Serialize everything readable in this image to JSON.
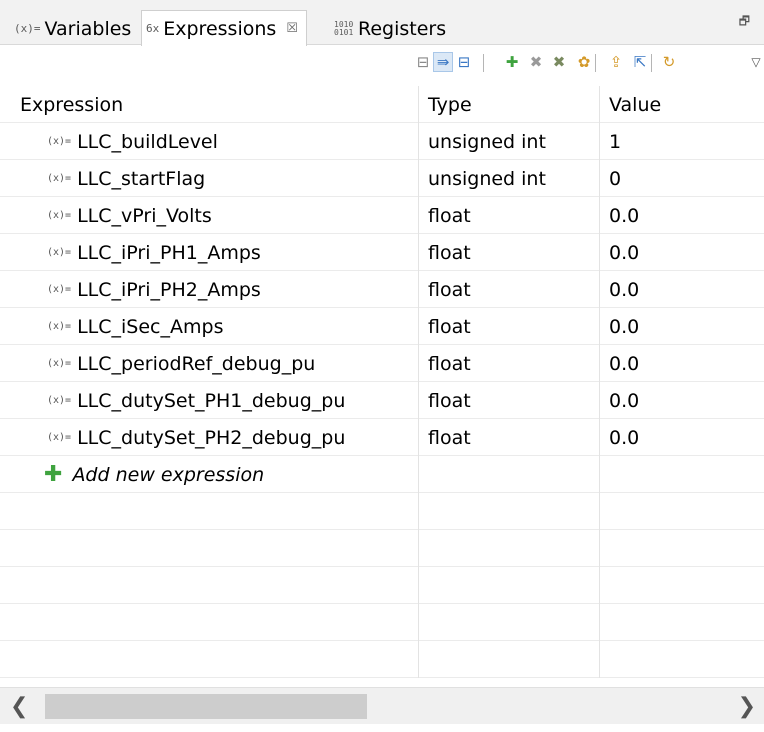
{
  "tabs": [
    {
      "icon": "(x)=",
      "label": "Variables",
      "active": false
    },
    {
      "icon": "6x",
      "label": "Expressions",
      "active": true,
      "close": "☒"
    },
    {
      "icon": "1010\n0101",
      "label": "Registers",
      "active": false
    }
  ],
  "maximize_icon": "🗗",
  "toolbar": {
    "buttons": [
      {
        "name": "show-type-names-icon",
        "glyph": "⊟",
        "color": "#8a8a8a"
      },
      {
        "name": "show-logical-structure-icon",
        "glyph": "⇛",
        "color": "#3b78c4",
        "selected": true
      },
      {
        "name": "collapse-all-icon",
        "glyph": "⊟",
        "color": "#3b78c4"
      },
      {
        "name": "add-expression-icon",
        "glyph": "✚",
        "color": "#3fa33f"
      },
      {
        "name": "remove-icon",
        "glyph": "✖",
        "color": "#9a9a9a"
      },
      {
        "name": "remove-all-icon",
        "glyph": "✖",
        "color": "#7a8a60"
      },
      {
        "name": "refresh-icon",
        "glyph": "✿",
        "color": "#d49a2a"
      },
      {
        "name": "import-icon",
        "glyph": "⇪",
        "color": "#d49a2a"
      },
      {
        "name": "export-icon",
        "glyph": "⇱",
        "color": "#3b78c4"
      },
      {
        "name": "continuous-refresh-icon",
        "glyph": "↻",
        "color": "#d49a2a"
      },
      {
        "name": "view-menu-icon",
        "glyph": "▽",
        "color": "#555555"
      }
    ]
  },
  "table": {
    "headers": {
      "expression": "Expression",
      "type": "Type",
      "value": "Value"
    },
    "var_icon": "(x)=",
    "rows": [
      {
        "expression": "LLC_buildLevel",
        "type": "unsigned int",
        "value": "1"
      },
      {
        "expression": "LLC_startFlag",
        "type": "unsigned int",
        "value": "0"
      },
      {
        "expression": "LLC_vPri_Volts",
        "type": "float",
        "value": "0.0"
      },
      {
        "expression": "LLC_iPri_PH1_Amps",
        "type": "float",
        "value": "0.0"
      },
      {
        "expression": "LLC_iPri_PH2_Amps",
        "type": "float",
        "value": "0.0"
      },
      {
        "expression": "LLC_iSec_Amps",
        "type": "float",
        "value": "0.0"
      },
      {
        "expression": "LLC_periodRef_debug_pu",
        "type": "float",
        "value": "0.0"
      },
      {
        "expression": "LLC_dutySet_PH1_debug_pu",
        "type": "float",
        "value": "0.0"
      },
      {
        "expression": "LLC_dutySet_PH2_debug_pu",
        "type": "float",
        "value": "0.0"
      }
    ],
    "add_new": "Add new expression",
    "add_icon": "✚"
  },
  "scrollbar": {
    "left": "❮",
    "right": "❯"
  }
}
